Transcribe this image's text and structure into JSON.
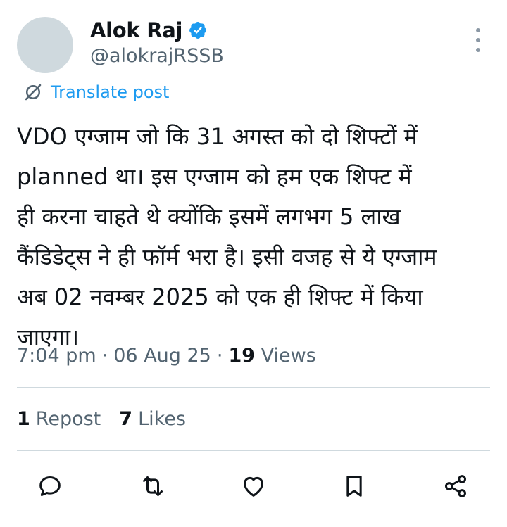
{
  "author": {
    "name": "Alok Raj",
    "handle": "@alokrajRSSB",
    "verified_color": "#1d9bf0"
  },
  "translate_label": "Translate post",
  "post_text": "VDO एग्जाम जो कि 31 अगस्त को दो शिफ्टों में\nplanned था। इस एग्जाम को हम एक शिफ्ट में\nही करना चाहते थे क्योंकि इसमें लगभग 5 लाख\nकैंडिडेट्स ने ही फॉर्म भरा है। इसी वजह से ये एग्जाम\nअब 02 नवम्बर 2025 को एक ही शिफ्ट में किया\nजाएगा।",
  "meta": {
    "time": "7:04 pm",
    "sep1": "·",
    "date": "06 Aug 25",
    "sep2": "·",
    "views_count": "19",
    "views_label": "Views"
  },
  "stats": {
    "reposts_count": "1",
    "reposts_label": "Repost",
    "likes_count": "7",
    "likes_label": "Likes"
  },
  "icons": {
    "reply": "reply-icon",
    "repost": "repost-icon",
    "like": "heart-icon",
    "bookmark": "bookmark-icon",
    "share": "share-icon"
  },
  "colors": {
    "accent": "#1d9bf0",
    "text": "#0f1419",
    "muted": "#536471"
  }
}
